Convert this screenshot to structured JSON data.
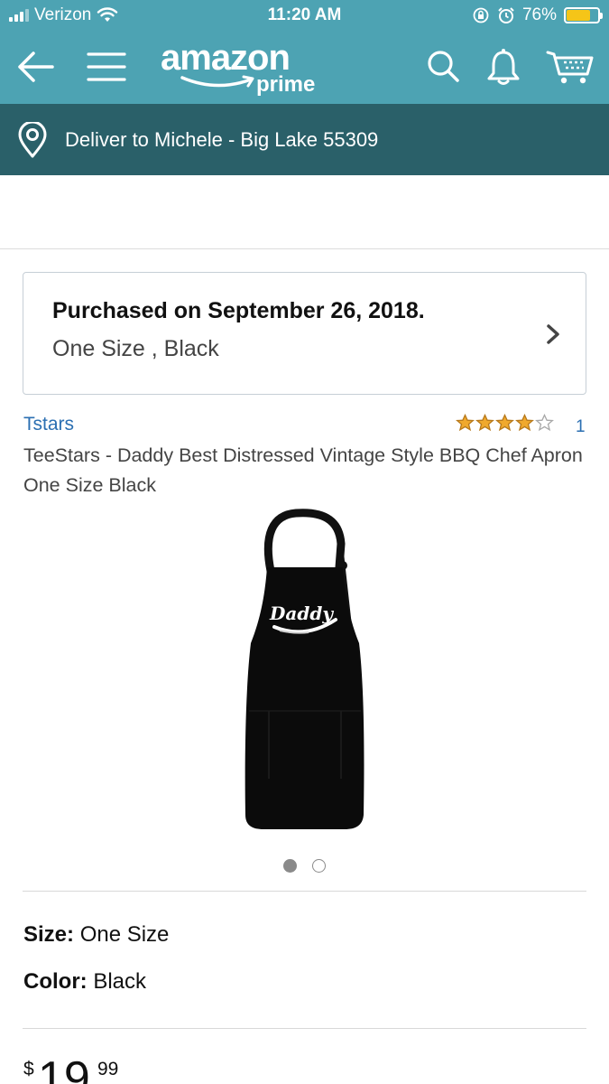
{
  "status_bar": {
    "carrier": "Verizon",
    "time": "11:20 AM",
    "battery_percent": "76%",
    "battery_level": 0.76,
    "icons": [
      "signal-icon",
      "wifi-icon",
      "rotation-lock-icon",
      "alarm-icon",
      "battery-icon"
    ]
  },
  "nav": {
    "logo_word": "amazon",
    "logo_prime": "prime",
    "icons": [
      "back-arrow-icon",
      "menu-icon",
      "search-icon",
      "bell-icon",
      "cart-icon"
    ]
  },
  "delivery": {
    "text": "Deliver to Michele - Big Lake 55309",
    "icon": "location-pin-icon"
  },
  "purchase_card": {
    "purchased_text": "Purchased on September 26, 2018.",
    "variant_text": "One Size , Black",
    "icon": "chevron-right-icon"
  },
  "product": {
    "brand": "Tstars",
    "rating": 4,
    "rating_max": 5,
    "rating_count": "1",
    "title": "TeeStars - Daddy Best Distressed Vintage Style BBQ Chef Apron One Size Black",
    "image_text": "Daddy",
    "carousel": {
      "total": 2,
      "active": 1
    }
  },
  "specs": {
    "size_label": "Size:",
    "size_value": "One Size",
    "color_label": "Color:",
    "color_value": "Black"
  },
  "price": {
    "currency": "$",
    "whole": "19",
    "fraction": "99"
  },
  "colors": {
    "header": "#4da3b3",
    "delivery_bar": "#2a6069",
    "link": "#2b6fb2",
    "star": "#f0a92d"
  }
}
